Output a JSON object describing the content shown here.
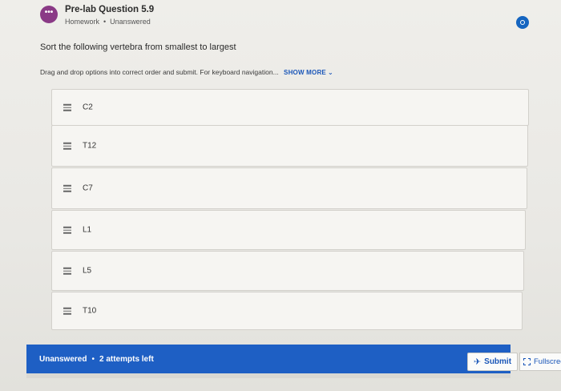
{
  "header": {
    "badge_text": "•••",
    "title": "Pre-lab Question 5.9",
    "category": "Homework",
    "status": "Unanswered"
  },
  "prompt": "Sort the following vertebra from smallest to largest",
  "instructions": {
    "text": "Drag and drop options into correct order and submit. For keyboard navigation...",
    "show_more": "SHOW MORE"
  },
  "options": [
    "C2",
    "T12",
    "C7",
    "L1",
    "L5",
    "T10"
  ],
  "footer": {
    "state": "Unanswered",
    "attempts": "2 attempts left",
    "submit_label": "Submit",
    "fullscreen_label": "Fullscreen"
  },
  "colors": {
    "accent": "#1e5fc4",
    "badge": "#8a3a86",
    "link": "#1a56b8"
  }
}
